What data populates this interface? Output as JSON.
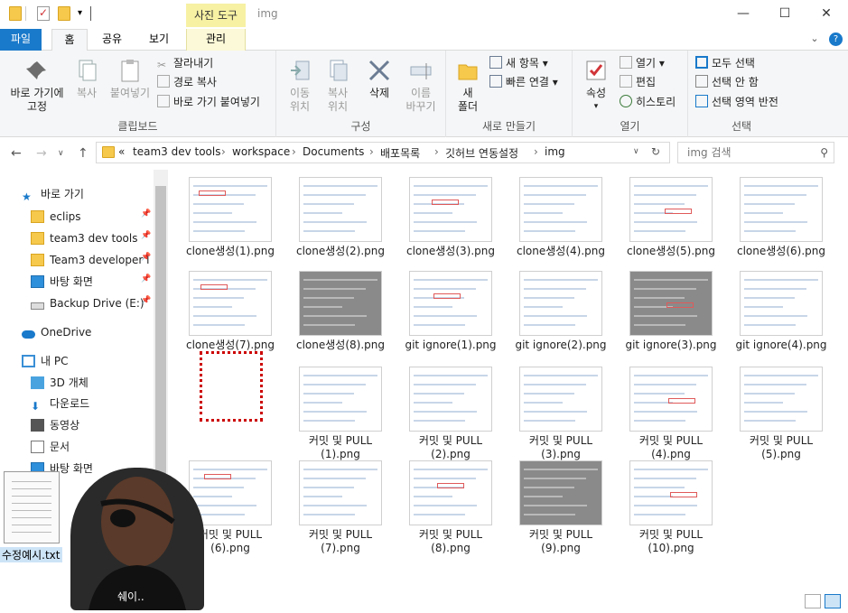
{
  "titlebar": {
    "context_tab_header": "사진 도구",
    "title": "img",
    "minimize": "—",
    "maximize": "☐",
    "close": "✕"
  },
  "tabs": {
    "file": "파일",
    "home": "홈",
    "share": "공유",
    "view": "보기",
    "manage": "관리"
  },
  "ribbon": {
    "clipboard": {
      "label": "클립보드",
      "pin": "바로 가기에\n고정",
      "copy": "복사",
      "paste": "붙여넣기",
      "cut": "잘라내기",
      "copy_path": "경로 복사",
      "paste_shortcut": "바로 가기 붙여넣기"
    },
    "organize": {
      "label": "구성",
      "move": "이동\n위치",
      "copyto": "복사\n위치",
      "delete": "삭제",
      "rename": "이름\n바꾸기"
    },
    "new": {
      "label": "새로 만들기",
      "new_folder": "새\n폴더",
      "new_item": "새 항목",
      "easy_access": "빠른 연결"
    },
    "open": {
      "label": "열기",
      "properties": "속성",
      "open": "열기",
      "edit": "편집",
      "history": "히스토리"
    },
    "select": {
      "label": "선택",
      "select_all": "모두 선택",
      "select_none": "선택 안 함",
      "invert": "선택 영역 반전"
    }
  },
  "address": {
    "crumbs": [
      "«",
      "team3 dev tools",
      "workspace",
      "Documents",
      "배포목록",
      "깃허브 연동설정",
      "img"
    ],
    "search_placeholder": "img 검색"
  },
  "nav": [
    {
      "label": "바로 가기",
      "icon": "star-icon"
    },
    {
      "label": "eclips",
      "icon": "folder-icon",
      "pinned": true
    },
    {
      "label": "team3 dev tools",
      "icon": "folder-icon",
      "pinned": true
    },
    {
      "label": "Team3 developer l",
      "icon": "folder-icon",
      "pinned": true
    },
    {
      "label": "바탕 화면",
      "icon": "desktop-icon",
      "pinned": true
    },
    {
      "label": "Backup Drive (E:)",
      "icon": "drive-icon",
      "pinned": true
    },
    {
      "label": "OneDrive",
      "icon": "cloud-icon"
    },
    {
      "label": "내 PC",
      "icon": "pc-icon"
    },
    {
      "label": "3D 개체",
      "icon": "cube-icon"
    },
    {
      "label": "다운로드",
      "icon": "download-icon"
    },
    {
      "label": "동영상",
      "icon": "video-icon"
    },
    {
      "label": "문서",
      "icon": "document-icon"
    },
    {
      "label": "바탕 화면",
      "icon": "desktop-icon"
    }
  ],
  "files": [
    {
      "name": "clone생성(1).png"
    },
    {
      "name": "clone생성(2).png"
    },
    {
      "name": "clone생성(3).png"
    },
    {
      "name": "clone생성(4).png"
    },
    {
      "name": "clone생성(5).png"
    },
    {
      "name": "clone생성(6).png"
    },
    {
      "name": "clone생성(7).png"
    },
    {
      "name": "clone생성(8).png"
    },
    {
      "name": "git ignore(1).png"
    },
    {
      "name": "git ignore(2).png"
    },
    {
      "name": "git ignore(3).png"
    },
    {
      "name": "git ignore(4).png"
    },
    {
      "name": ""
    },
    {
      "name": "커밋 및 PULL\n(1).png"
    },
    {
      "name": "커밋 및 PULL\n(2).png"
    },
    {
      "name": "커밋 및 PULL\n(3).png"
    },
    {
      "name": "커밋 및 PULL\n(4).png"
    },
    {
      "name": "커밋 및 PULL\n(5).png"
    },
    {
      "name": "커밋 및 PULL\n(6).png"
    },
    {
      "name": "커밋 및 PULL\n(7).png"
    },
    {
      "name": "커밋 및 PULL\n(8).png"
    },
    {
      "name": "커밋 및 PULL\n(9).png"
    },
    {
      "name": "커밋 및 PULL\n(10).png"
    }
  ],
  "overlay": {
    "doc_name": "수정예시.txt",
    "caption": "쉐이.."
  },
  "colors": {
    "accent": "#1979ca",
    "context": "#f7f1a4"
  }
}
